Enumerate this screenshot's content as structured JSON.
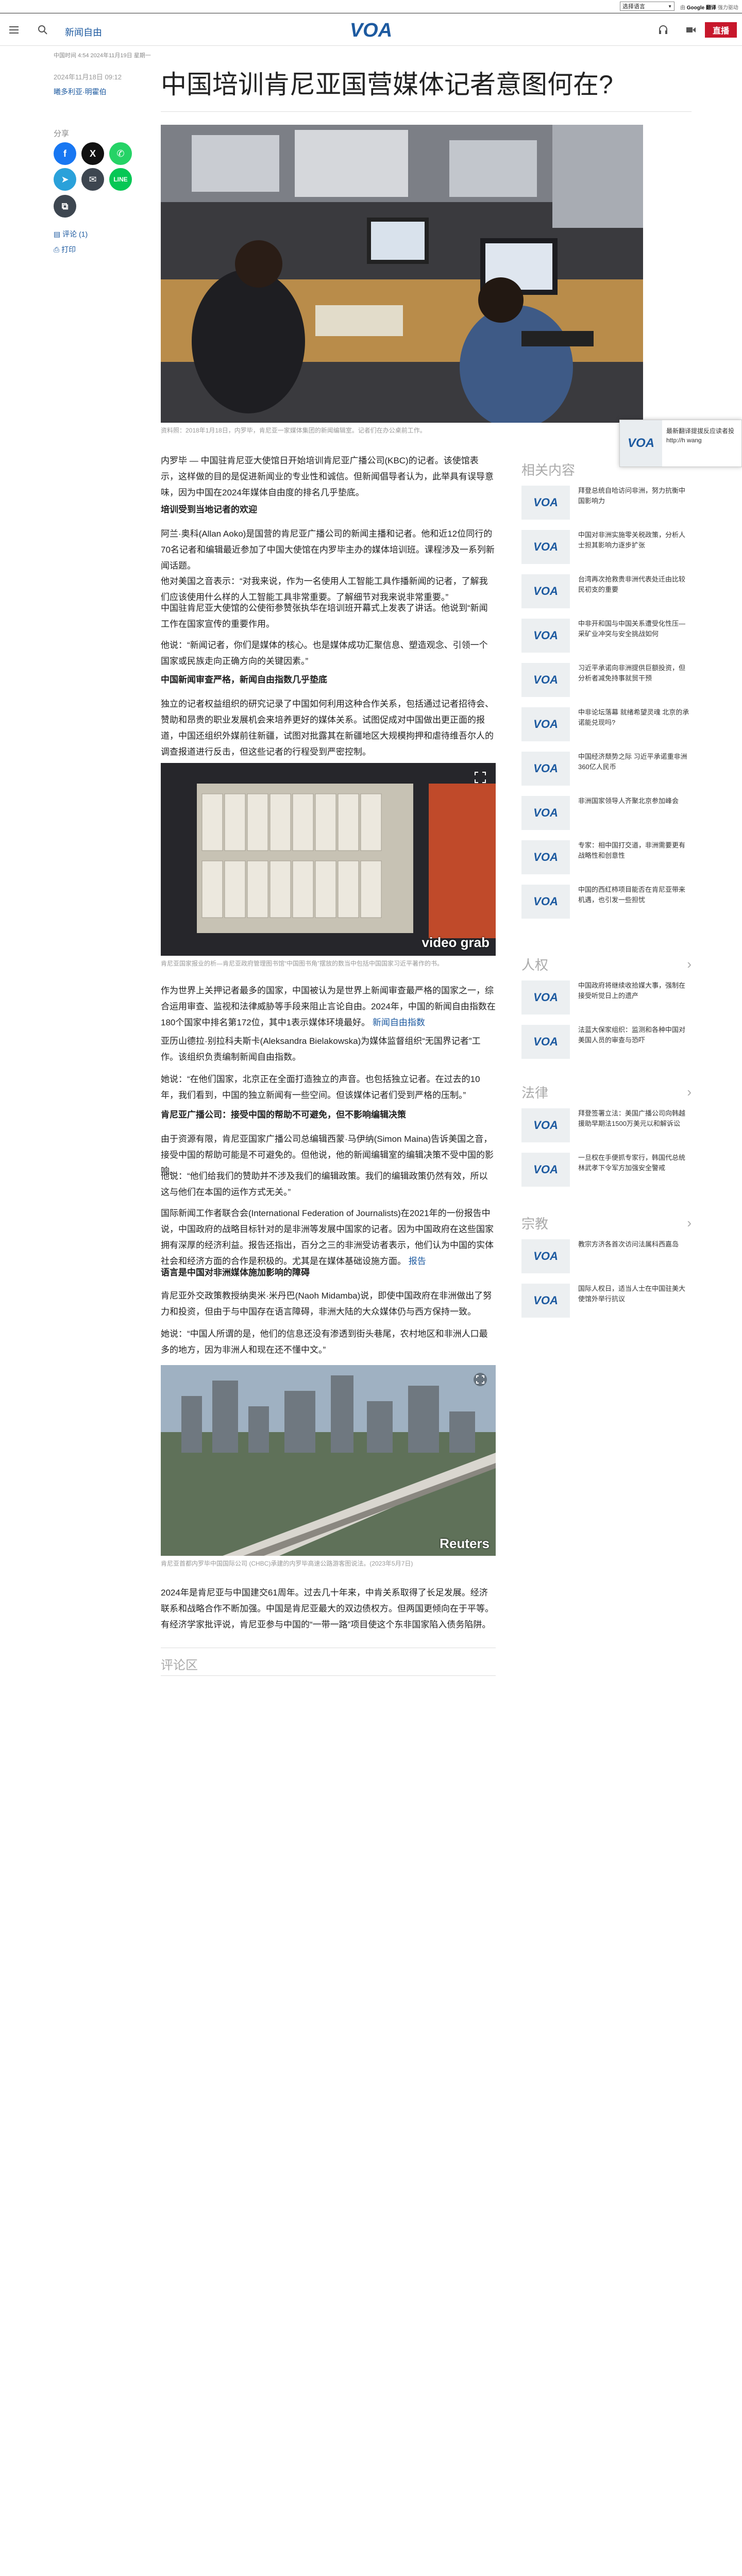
{
  "top_bar": {
    "language_select": "选择语言",
    "translate_by": "由",
    "translate_brand": "Google",
    "translate_word": "翻译",
    "translate_suffix": "强力驱动"
  },
  "nav": {
    "section": "新闻自由",
    "logo": "VOA",
    "live_label": "直播"
  },
  "article": {
    "breadcrumb": "中国时间 4:54 2024年11月19日 星期一",
    "date": "2024年11月18日 09:12",
    "author": "曦多利亚·明霍伯",
    "title": "中国培训肯尼亚国营媒体记者意图何在?",
    "share_label": "分享",
    "comments_link": "评论 (1)",
    "print_link": "打印",
    "hero_caption": "资料照：2018年1月18日，内罗毕，肯尼亚一家媒体集团的新闻编辑室。记者们在办公桌前工作。",
    "p1": "内罗毕 — 中国驻肯尼亚大使馆日开始培训肯尼亚广播公司(KBC)的记者。该使馆表示，这样做的目的是促进新闻业的专业性和诚信。但新闻倡导者认为，此举具有误导意味，因为中国在2024年媒体自由度的排名几乎垫底。",
    "h1": "培训受到当地记者的欢迎",
    "p2": "阿兰·奥科(Allan Aoko)是国营的肯尼亚广播公司的新闻主播和记者。他和近12位同行的70名记者和编辑最近参加了中国大使馆在内罗毕主办的媒体培训班。课程涉及一系列新闻话题。",
    "p3": "他对美国之音表示：“对我来说，作为一名使用人工智能工具作播新闻的记者，了解我们应该使用什么样的人工智能工具非常重要。了解细节对我来说非常重要。”",
    "p4": "中国驻肯尼亚大使馆的公使衔参赞张执华在培训班开幕式上发表了讲话。他说到“新闻工作在国家宣传的重要作用。",
    "p5": "他说：“新闻记者，你们是媒体的核心。也是媒体成功汇聚信息、塑造观念、引领一个国家或民族走向正确方向的关键因素。”",
    "h2": "中国新闻审查严格，新闻自由指数几乎垫底",
    "p6": "独立的记者权益组织的研究记录了中国如何利用这种合作关系，包括通过记者招待会、赞助和昂贵的职业发展机会来培养更好的媒体关系。试图促成对中国做出更正面的报道，中国还组织外媒前往新疆，试图对批露其在新疆地区大规模拘押和虐待维吾尔人的调查报道进行反击，但这些记者的行程受到严密控制。",
    "img2_caption": "肯尼亚国家报业的析—肯尼亚政府管理图书馆“中国图书角”摆放的数当中包括中国国家习近平著作的书。",
    "p7": "作为世界上关押记者最多的国家，中国被认为是世界上新闻审查最严格的国家之一，综合运用审查、监视和法律威胁等手段来阻止言论自由。2024年，中国的新闻自由指数在180个国家中排名第172位，其中1表示媒体环境最好。",
    "p7_link": "新闻自由指数",
    "p8": "亚历山德拉·别拉科夫斯卡(Aleksandra Bielakowska)为媒体监督组织“无国界记者”工作。该组织负责编制新闻自由指数。",
    "p9": "她说：“在他们国家，北京正在全面打造独立的声音。也包括独立记者。在过去的10年，我们看到，中国的独立新闻有一些空间。但该媒体记者们受到严格的压制。”",
    "h3": "肯尼亚广播公司：接受中国的帮助不可避免，但不影响编辑决策",
    "p10": "由于资源有限，肯尼亚国家广播公司总编辑西蒙·马伊纳(Simon Maina)告诉美国之音，接受中国的帮助可能是不可避免的。但他说，他的新闻编辑室的编辑决策不受中国的影响。",
    "p11": "他说：“他们给我们的赞助并不涉及我们的编辑政策。我们的编辑政策仍然有效，所以这与他们在本国的运作方式无关。”",
    "p12": "国际新闻工作者联合会(International Federation of Journalists)在2021年的一份报告中说，中国政府的战略目标针对的是非洲等发展中国家的记者。因为中国政府在这些国家拥有深厚的经济利益。报告还指出，百分之三的非洲受访者表示，他们认为中国的实体社会和经济方面的合作是积极的。尤其是在媒体基础设施方面。",
    "p12_link": "报告",
    "h4": "语言是中国对非洲媒体施加影响的障碍",
    "p13": "肯尼亚外交政策教授纳奥米·米丹巴(Naoh Midamba)说，即使中国政府在非洲做出了努力和投资，但由于与中国存在语言障碍，非洲大陆的大众媒体仍与西方保持一致。",
    "p14": "她说：“中国人所谓的是，他们的信息还没有渗透到街头巷尾，农村地区和非洲人口最多的地方，因为非洲人和现在还不懂中文。”",
    "img3_caption": "肯尼亚首都内罗毕中国国际公司 (CHBC)承建的内罗毕高速公路游客图说法。(2023年5月7日)",
    "p15": "2024年是肯尼亚与中国建交61周年。过去几十年来，中肯关系取得了长足发展。经济联系和战略合作不断加强。中国是肯尼亚最大的双边债权方。但两国更倾向在于平等。有经济学家批评说，肯尼亚参与中国的“一带一路”项目使这个东非国家陷入债务陷阱。",
    "img2_watermark": "video grab",
    "img3_watermark": "Reuters",
    "comments_header": "评论区"
  },
  "popup": {
    "logo": "VOA",
    "text": "最新翻译提拔反应读者投 http://h wang"
  },
  "sidebar": {
    "sections": [
      {
        "title": "相关内容",
        "items": [
          {
            "logo": "VOA",
            "text": "拜登总统自哈访问非洲，努力抗衡中国影响力"
          },
          {
            "logo": "VOA",
            "text": "中国对非洲实施零关税政策，分析人士担其影响力逐步扩张"
          },
          {
            "logo": "VOA",
            "text": "台湾再次抢救贵非洲代表处迁由比较民初支的重要"
          },
          {
            "logo": "VOA",
            "text": "中非开和国与中国关系遭受化性压—采矿业冲突与安全挑战如何"
          },
          {
            "logo": "VOA",
            "text": "习近平承诺向非洲提供巨额投资，但分析者减免持事就贸干预"
          },
          {
            "logo": "VOA",
            "text": "中非论坛落幕 就绪希望灵魂 北京的承诺能兑现吗?"
          },
          {
            "logo": "VOA",
            "text": "中国经济颓势之际 习近平承诺重非洲360亿人民币"
          },
          {
            "logo": "VOA",
            "text": "非洲国家领导人齐聚北京参加峰会"
          },
          {
            "logo": "VOA",
            "text": "专家：相中国打交道，非洲需要更有战略性和创意性"
          },
          {
            "logo": "VOA",
            "text": "中国的西红柿项目能否在肯尼亚带来机遇，也引发一些担忧"
          }
        ]
      },
      {
        "title": "人权",
        "items": [
          {
            "logo": "VOA",
            "text": "中国政府将继续收拾媒大事，强制在接受听觉日上的遗产"
          },
          {
            "logo": "VOA",
            "text": "法蓝大保家组织：监测和各种中国对美国人员的审查与恐吓"
          }
        ]
      },
      {
        "title": "法律",
        "items": [
          {
            "logo": "VOA",
            "text": "拜登签署立法：美国广播公司向韩越援助早期法1500万美元以和解诉讼"
          },
          {
            "logo": "VOA",
            "text": "一旦权在手便抓专家行，韩国代总统林武孝下令军方加强安全警戒"
          }
        ]
      },
      {
        "title": "宗教",
        "items": [
          {
            "logo": "VOA",
            "text": "教宗方济各首次访问法属科西嘉岛"
          },
          {
            "logo": "VOA",
            "text": "国际人权日，适当人士在中国驻美大使馆外举行抗议"
          }
        ]
      }
    ]
  },
  "colors": {
    "accent": "#1d5aa0",
    "live": "#c7172b",
    "facebook": "#1877f2",
    "x": "#111111",
    "whatsapp": "#25d366",
    "telegram": "#2aa1da",
    "email": "#3d4650",
    "line": "#06c755",
    "copy": "#3d4650"
  },
  "icons": {
    "menu": "hamburger-icon",
    "search": "search-icon",
    "logo": "voa-logo-icon",
    "audio": "headphones-icon",
    "video": "video-icon",
    "expand": "expand-icon",
    "comment": "comment-icon",
    "print": "print-icon"
  }
}
